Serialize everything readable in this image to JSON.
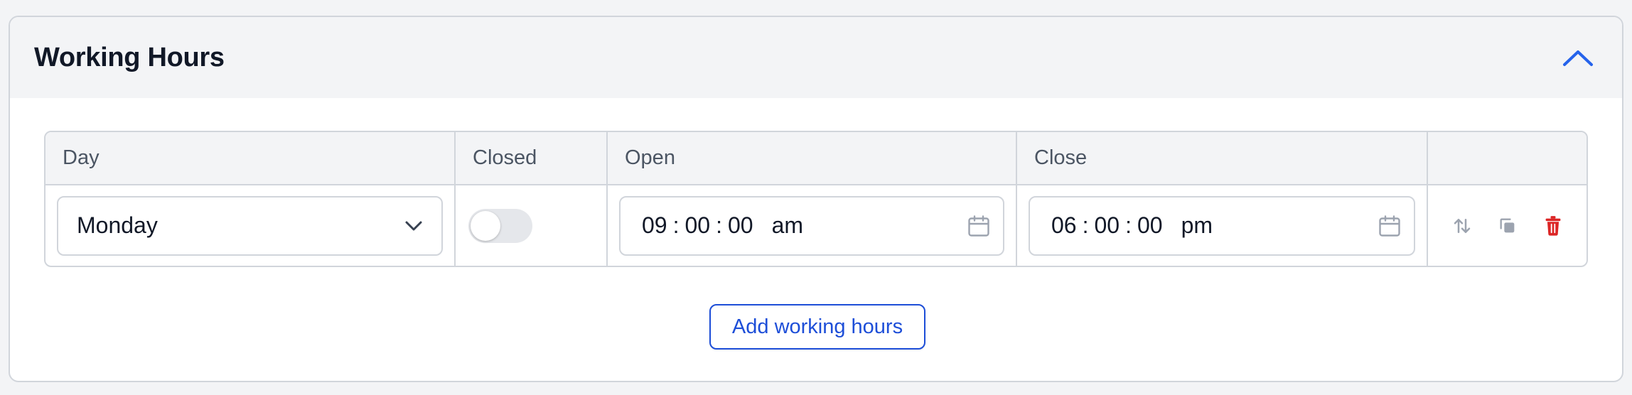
{
  "panel": {
    "title": "Working Hours"
  },
  "table": {
    "headers": {
      "day": "Day",
      "closed": "Closed",
      "open": "Open",
      "close": "Close",
      "actions": ""
    },
    "rows": [
      {
        "day": "Monday",
        "closed": false,
        "open": {
          "hh": "09",
          "mm": "00",
          "ss": "00",
          "ampm": "am"
        },
        "close": {
          "hh": "06",
          "mm": "00",
          "ss": "00",
          "ampm": "pm"
        }
      }
    ]
  },
  "add_button": "Add working hours",
  "colors": {
    "accent": "#1d4ed8",
    "danger": "#dc2626",
    "muted_icon": "#9ca3af"
  },
  "icons": [
    "chevron-up-icon",
    "chevron-down-icon",
    "calendar-icon",
    "sort-icon",
    "copy-icon",
    "trash-icon"
  ]
}
